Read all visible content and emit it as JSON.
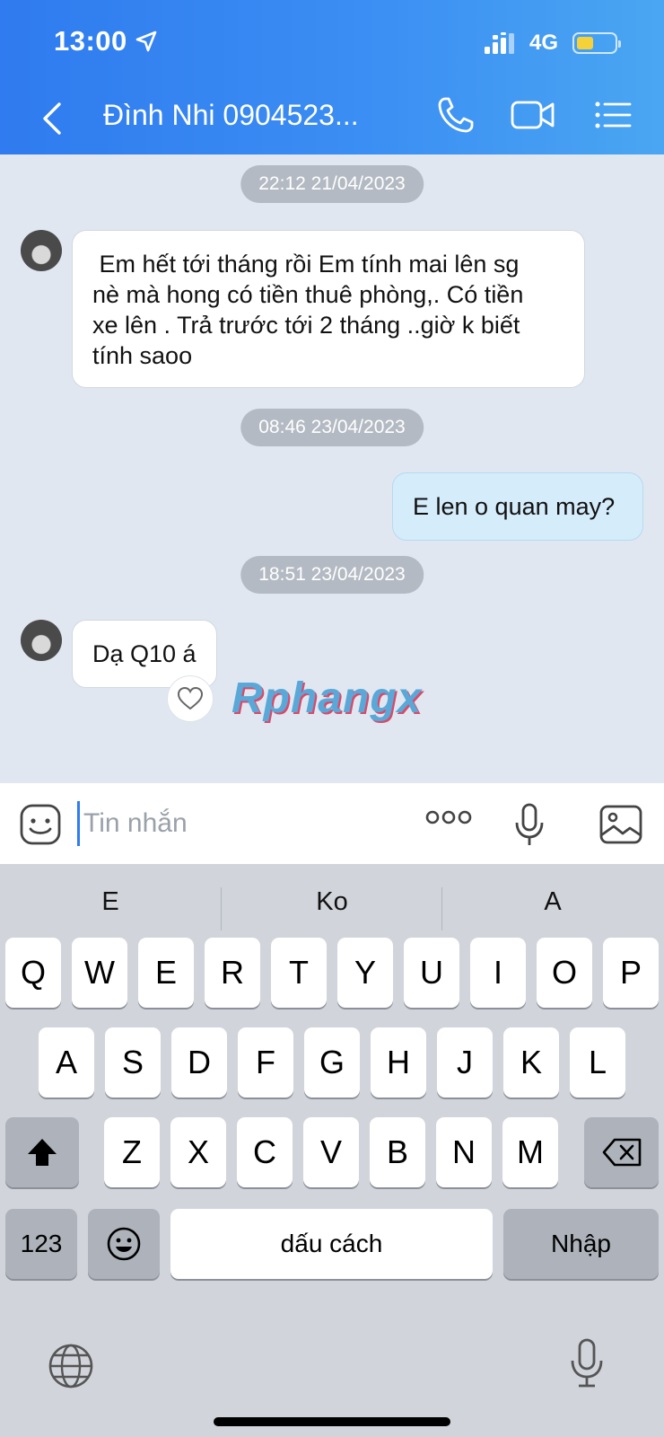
{
  "status_bar": {
    "time": "13:00",
    "network": "4G",
    "battery_level": 0.45,
    "battery_color": "#f6d23a"
  },
  "header": {
    "contact_title": "Đình Nhi 0904523...",
    "accent_color": "#2f7bef"
  },
  "messages": [
    {
      "type": "timestamp",
      "text": "22:12 21/04/2023"
    },
    {
      "type": "incoming",
      "lines": [
        " Em hết tới tháng rồi Em tính mai lên sg",
        "nè mà hong có tiền thuê phòng,. Có tiền",
        "xe lên . Trả trước tới 2 tháng ..giờ k biết",
        "tính saoo"
      ]
    },
    {
      "type": "timestamp",
      "text": "08:46 23/04/2023"
    },
    {
      "type": "outgoing",
      "text": "E len o quan may?"
    },
    {
      "type": "timestamp",
      "text": "18:51 23/04/2023"
    },
    {
      "type": "incoming",
      "text": "Dạ Q10 á"
    }
  ],
  "watermark": "Rphangx",
  "composer": {
    "placeholder": "Tin nhắn"
  },
  "keyboard": {
    "suggestions": [
      "E",
      "Ko",
      "A"
    ],
    "row1": [
      "Q",
      "W",
      "E",
      "R",
      "T",
      "Y",
      "U",
      "I",
      "O",
      "P"
    ],
    "row2": [
      "A",
      "S",
      "D",
      "F",
      "G",
      "H",
      "J",
      "K",
      "L"
    ],
    "row3": [
      "Z",
      "X",
      "C",
      "V",
      "B",
      "N",
      "M"
    ],
    "numbers_key": "123",
    "space_key": "dấu cách",
    "return_key": "Nhập"
  }
}
